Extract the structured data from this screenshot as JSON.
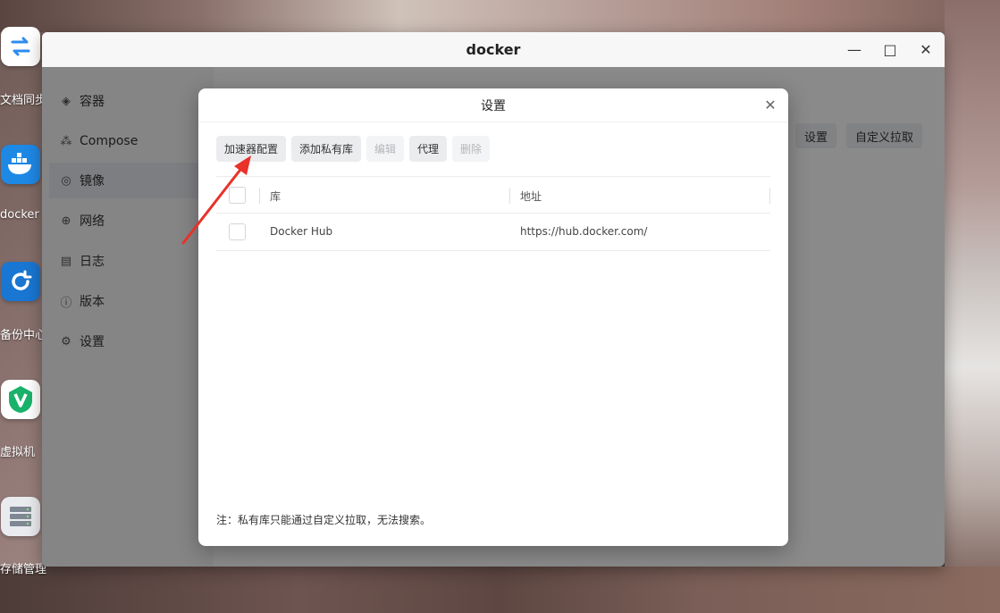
{
  "desktop": {
    "icons": [
      {
        "label": "文档同步",
        "icon": "sync-arrows-icon",
        "color": "#2f8cf0"
      },
      {
        "label": "docker",
        "icon": "docker-whale-icon",
        "color": "#1e88e5"
      },
      {
        "label": "备份中心",
        "icon": "backup-cycle-icon",
        "color": "#1976d2"
      },
      {
        "label": "虚拟机",
        "icon": "v-shield-icon",
        "color": "#19b26b"
      },
      {
        "label": "存储管理",
        "icon": "storage-server-icon",
        "color": "#8a919c"
      }
    ]
  },
  "window": {
    "title": "docker",
    "controls": {
      "minimize": "—",
      "maximize": "□",
      "close": "✕"
    }
  },
  "sidebar": {
    "items": [
      {
        "label": "容器",
        "icon": "layers-icon"
      },
      {
        "label": "Compose",
        "icon": "cubes-icon"
      },
      {
        "label": "镜像",
        "icon": "target-icon"
      },
      {
        "label": "网络",
        "icon": "globe-icon"
      },
      {
        "label": "日志",
        "icon": "document-icon"
      },
      {
        "label": "版本",
        "icon": "info-icon"
      },
      {
        "label": "设置",
        "icon": "gear-icon"
      }
    ],
    "active_index": 2
  },
  "background_toolbar": {
    "settings_label": "设置",
    "custom_pull_label": "自定义拉取"
  },
  "dialog": {
    "title": "设置",
    "close": "✕",
    "toolbar": {
      "accelerator": "加速器配置",
      "add_private": "添加私有库",
      "edit": "编辑",
      "proxy": "代理",
      "delete": "删除"
    },
    "table": {
      "columns": [
        "库",
        "地址"
      ],
      "rows": [
        {
          "name": "Docker Hub",
          "address": "https://hub.docker.com/"
        }
      ]
    },
    "note": "注：私有库只能通过自定义拉取，无法搜索。"
  },
  "colors": {
    "annotation_arrow": "#e8322a",
    "overlay": "rgba(0,0,0,0.45)"
  }
}
